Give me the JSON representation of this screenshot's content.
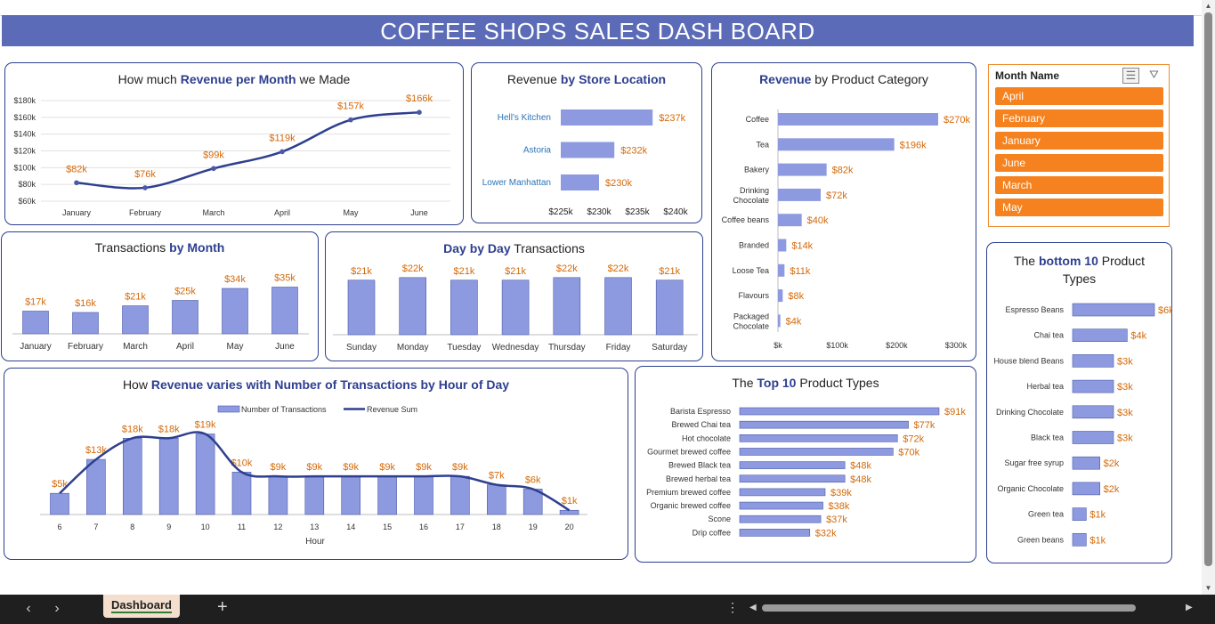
{
  "dashboard_title": "COFFEE SHOPS SALES DASH BOARD",
  "colors": {
    "bar": "#8e9ae0",
    "bar_stroke": "#4a5aa8",
    "line": "#2e3f8f",
    "label": "#d46a0a",
    "band": "#5b6bb7",
    "slicer": "#f5821f",
    "axis_text": "#333333",
    "store_label": "#2b74b8"
  },
  "monthly_revenue": {
    "title_pre": "How much ",
    "title_bold": "Revenue per Month",
    "title_post": "  we Made",
    "chart_data": {
      "type": "line",
      "categories": [
        "January",
        "February",
        "March",
        "April",
        "May",
        "June"
      ],
      "values": [
        82,
        76,
        99,
        119,
        157,
        166
      ],
      "data_labels": [
        "$82k",
        "$76k",
        "$99k",
        "$119k",
        "$157k",
        "$166k"
      ],
      "y_ticks": [
        "$60k",
        "$80k",
        "$100k",
        "$120k",
        "$140k",
        "$160k",
        "$180k"
      ],
      "ylim": [
        60,
        180
      ],
      "grid": true
    }
  },
  "store_revenue": {
    "title_pre": "Revenue ",
    "title_bold": "by Store Location",
    "chart_data": {
      "type": "bar",
      "orientation": "horizontal",
      "categories": [
        "Hell's Kitchen",
        "Astoria",
        "Lower Manhattan"
      ],
      "values": [
        237,
        232,
        230
      ],
      "data_labels": [
        "$237k",
        "$232k",
        "$230k"
      ],
      "x_ticks": [
        "$225k",
        "$230k",
        "$235k",
        "$240k"
      ],
      "xlim": [
        225,
        240
      ]
    }
  },
  "category_revenue": {
    "title_bold": "Revenue",
    "title_post": " by Product Category",
    "chart_data": {
      "type": "bar",
      "orientation": "horizontal",
      "categories": [
        "Coffee",
        "Tea",
        "Bakery",
        "Drinking Chocolate",
        "Coffee beans",
        "Branded",
        "Loose Tea",
        "Flavours",
        "Packaged Chocolate"
      ],
      "values": [
        270,
        196,
        82,
        72,
        40,
        14,
        11,
        8,
        4
      ],
      "data_labels": [
        "$270k",
        "$196k",
        "$82k",
        "$72k",
        "$40k",
        "$14k",
        "$11k",
        "$8k",
        "$4k"
      ],
      "x_ticks": [
        "$k",
        "$100k",
        "$200k",
        "$300k"
      ],
      "xlim": [
        0,
        300
      ]
    }
  },
  "slicer": {
    "header": "Month Name",
    "items": [
      "April",
      "February",
      "January",
      "June",
      "March",
      "May"
    ]
  },
  "month_transactions": {
    "title_pre": "Transactions ",
    "title_bold": "by  Month",
    "chart_data": {
      "type": "bar",
      "categories": [
        "January",
        "February",
        "March",
        "April",
        "May",
        "June"
      ],
      "values": [
        17,
        16,
        21,
        25,
        34,
        35
      ],
      "data_labels": [
        "$17k",
        "$16k",
        "$21k",
        "$25k",
        "$34k",
        "$35k"
      ],
      "ylim": [
        0,
        38
      ]
    }
  },
  "day_transactions": {
    "title_bold": "Day by Day",
    "title_post": " Transactions",
    "chart_data": {
      "type": "bar",
      "categories": [
        "Sunday",
        "Monday",
        "Tuesday",
        "Wednesday",
        "Thursday",
        "Friday",
        "Saturday"
      ],
      "values": [
        21,
        22,
        21,
        21,
        22,
        22,
        21
      ],
      "data_labels": [
        "$21k",
        "$22k",
        "$21k",
        "$21k",
        "$22k",
        "$22k",
        "$21k"
      ],
      "ylim": [
        0,
        24
      ]
    }
  },
  "hourly": {
    "title_pre": "How ",
    "title_bold": "Revenue varies with Number of Transactions by Hour of Day",
    "legend_bar": "Number of Transactions",
    "legend_line": "Revenue Sum",
    "xlabel": "Hour",
    "chart_data": {
      "type": "bar",
      "categories": [
        "6",
        "7",
        "8",
        "9",
        "10",
        "11",
        "12",
        "13",
        "14",
        "15",
        "16",
        "17",
        "18",
        "19",
        "20"
      ],
      "series": [
        {
          "name": "Number of Transactions",
          "type": "bar",
          "values": [
            5,
            13,
            18,
            18,
            19,
            10,
            9,
            9,
            9,
            9,
            9,
            9,
            7,
            6,
            1
          ]
        },
        {
          "name": "Revenue Sum",
          "type": "line",
          "values": [
            5,
            13,
            18,
            18,
            19,
            10,
            9,
            9,
            9,
            9,
            9,
            9,
            7,
            6,
            1
          ]
        }
      ],
      "data_labels": [
        "$5k",
        "$13k",
        "$18k",
        "$18k",
        "$19k",
        "$10k",
        "$9k",
        "$9k",
        "$9k",
        "$9k",
        "$9k",
        "$9k",
        "$7k",
        "$6k",
        "$1k"
      ],
      "ylim": [
        0,
        21
      ]
    }
  },
  "top10": {
    "title_pre": "The ",
    "title_bold": "Top 10",
    "title_post": " Product Types",
    "chart_data": {
      "type": "bar",
      "orientation": "horizontal",
      "categories": [
        "Barista Espresso",
        "Brewed Chai tea",
        "Hot chocolate",
        "Gourmet brewed coffee",
        "Brewed Black tea",
        "Brewed herbal tea",
        "Premium brewed coffee",
        "Organic brewed coffee",
        "Scone",
        "Drip coffee"
      ],
      "values": [
        91,
        77,
        72,
        70,
        48,
        48,
        39,
        38,
        37,
        32
      ],
      "data_labels": [
        "$91k",
        "$77k",
        "$72k",
        "$70k",
        "$48k",
        "$48k",
        "$39k",
        "$38k",
        "$37k",
        "$32k"
      ],
      "xlim": [
        0,
        91
      ]
    }
  },
  "bottom10": {
    "title_pre": "The ",
    "title_bold": "bottom 10",
    "title_post": " Product",
    "title_line2": "Types",
    "chart_data": {
      "type": "bar",
      "orientation": "horizontal",
      "categories": [
        "Espresso Beans",
        "Chai tea",
        "House blend Beans",
        "Herbal tea",
        "Drinking Chocolate",
        "Black tea",
        "Sugar free syrup",
        "Organic Chocolate",
        "Green tea",
        "Green beans"
      ],
      "values": [
        6,
        4,
        3,
        3,
        3,
        3,
        2,
        2,
        1,
        1
      ],
      "data_labels": [
        "$6k",
        "$4k",
        "$3k",
        "$3k",
        "$3k",
        "$3k",
        "$2k",
        "$2k",
        "$1k",
        "$1k"
      ],
      "xlim": [
        0,
        6
      ]
    }
  },
  "sheet_tab": "Dashboard"
}
